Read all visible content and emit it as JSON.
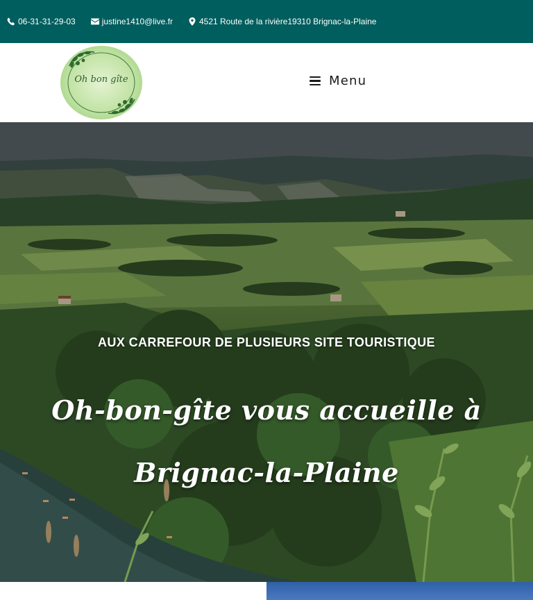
{
  "topbar": {
    "phone": "06-31-31-29-03",
    "email": "justine1410@live.fr",
    "address": "4521 Route de la rivière19310 Brignac-la-Plaine",
    "background": "#015e5e"
  },
  "header": {
    "logo_text": "Oh bon gîte",
    "menu_label": "Menu"
  },
  "hero": {
    "kicker": "AUX CARREFOUR DE PLUSIEURS SITE TOURISTIQUE",
    "title": "Oh-bon-gîte vous accueille à Brignac-la-Plaine"
  },
  "icons": {
    "phone": "phone-icon",
    "email": "envelope-icon",
    "address": "map-marker-icon",
    "menu": "hamburger-icon"
  }
}
